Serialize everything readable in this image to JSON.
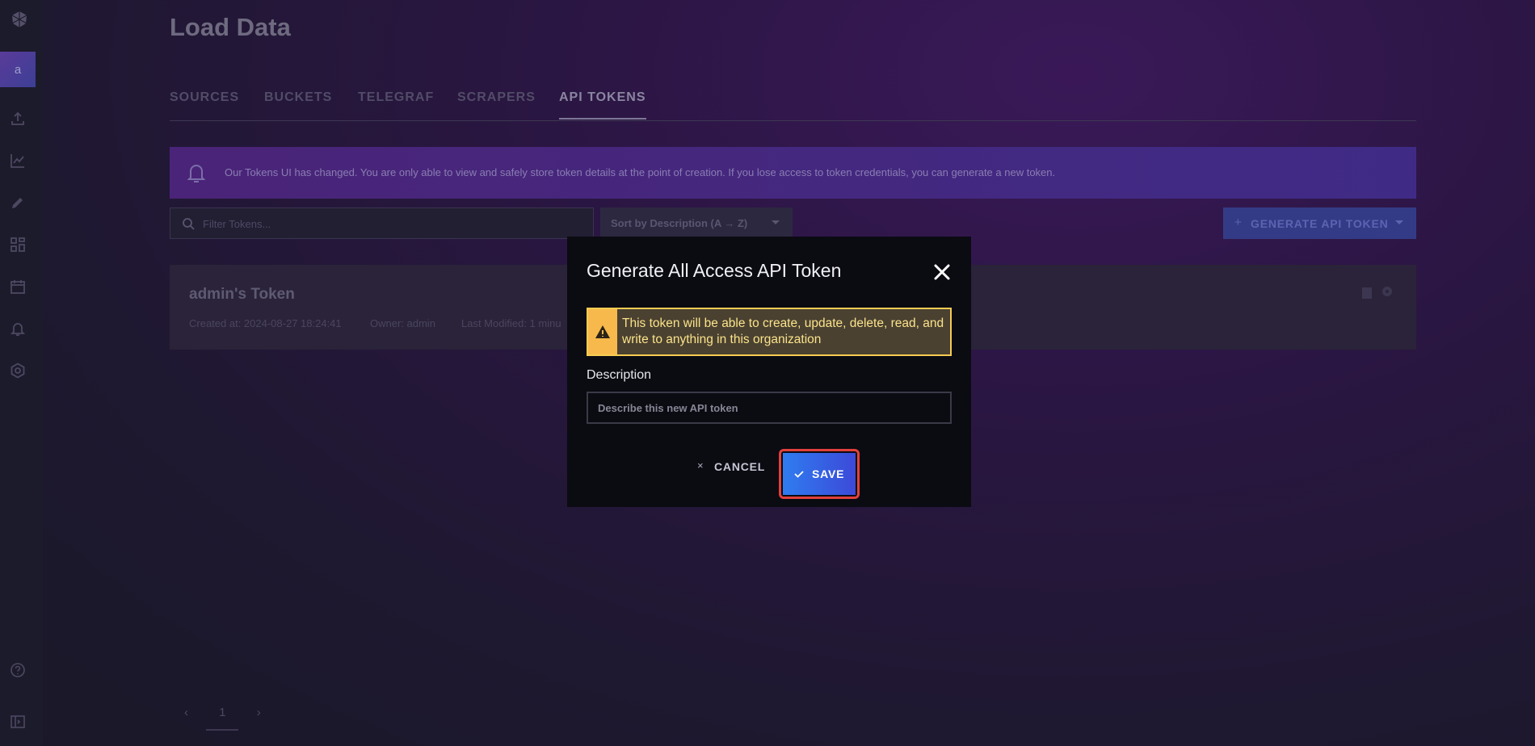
{
  "sidebar": {
    "org_initial": "a",
    "icons": [
      "upload-icon",
      "chart-icon",
      "pencil-icon",
      "dashboards-icon",
      "calendar-icon",
      "bell-icon",
      "gear-icon",
      "help-icon",
      "collapse-icon"
    ]
  },
  "page": {
    "title": "Load Data",
    "tabs": [
      {
        "label": "SOURCES"
      },
      {
        "label": "BUCKETS"
      },
      {
        "label": "TELEGRAF"
      },
      {
        "label": "SCRAPERS"
      },
      {
        "label": "API TOKENS",
        "active": true
      }
    ],
    "banner_text": "Our Tokens UI has changed. You are only able to view and safely store token details at the point of creation. If you lose access to token credentials, you can generate a new token.",
    "filter_placeholder": "Filter Tokens...",
    "sort_label": "Sort by Description (A → Z)",
    "generate_label": "GENERATE API TOKEN",
    "generate_plus": "+",
    "token": {
      "name": "admin's Token",
      "created": "Created at: 2024-08-27 18:24:41",
      "owner": "Owner: admin",
      "modified": "Last Modified: 1 minu"
    },
    "pager": {
      "current": "1",
      "prev": "‹",
      "next": "›"
    }
  },
  "modal": {
    "title": "Generate All Access API Token",
    "warning": "This token will be able to create, update, delete, read, and write to anything in this organization",
    "description_label": "Description",
    "description_placeholder": "Describe this new API token",
    "cancel_label": "CANCEL",
    "cancel_x": "×",
    "save_label": "SAVE"
  },
  "colors": {
    "accent_blue": "#2f7cf0",
    "warning_yellow": "#f7cc52",
    "highlight_red": "#e2403c"
  }
}
